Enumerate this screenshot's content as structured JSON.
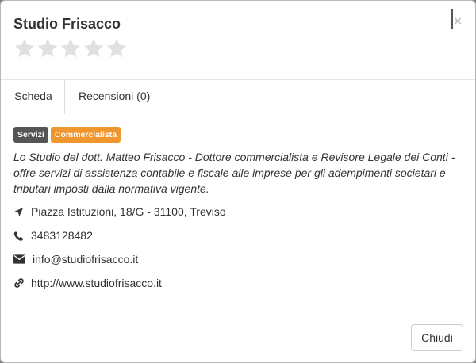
{
  "header": {
    "title": "Studio Frisacco",
    "rating": 0,
    "rating_max": 5,
    "close_label": "×"
  },
  "tabs": [
    {
      "label": "Scheda",
      "active": true
    },
    {
      "label": "Recensioni (0)",
      "active": false
    }
  ],
  "labels": [
    {
      "text": "Servizi",
      "color": "#555555"
    },
    {
      "text": "Commercialista",
      "color": "#f0962e"
    }
  ],
  "description": "Lo Studio del dott. Matteo Frisacco - Dottore commercialista e Revisore Legale dei Conti - offre servizi di assistenza contabile e fiscale alle imprese per gli adempimenti societari e tributari imposti dalla normativa vigente.",
  "contacts": {
    "address": "Piazza Istituzioni, 18/G - 31100, Treviso",
    "phone": "3483128482",
    "email": "info@studiofrisacco.it",
    "website": "http://www.studiofrisacco.it"
  },
  "icons": {
    "address": "location-arrow-icon",
    "phone": "phone-icon",
    "email": "envelope-icon",
    "website": "link-icon"
  },
  "footer": {
    "close_button_label": "Chiudi"
  }
}
